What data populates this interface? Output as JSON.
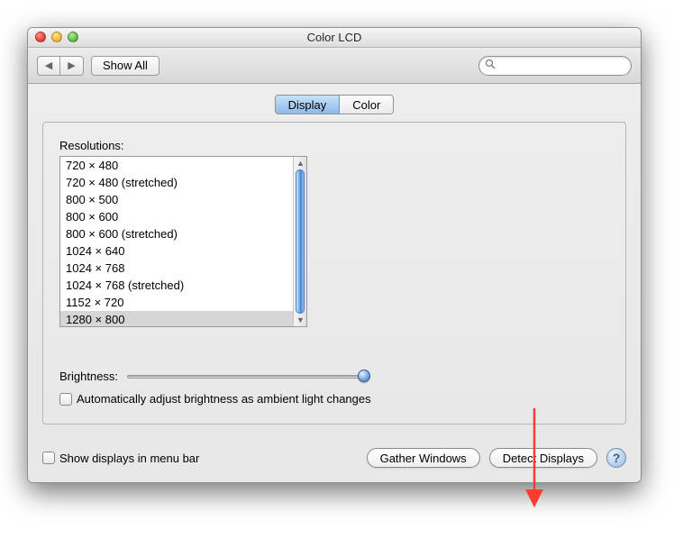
{
  "window": {
    "title": "Color LCD"
  },
  "toolbar": {
    "showAll": "Show All"
  },
  "tabs": {
    "display": "Display",
    "color": "Color"
  },
  "labels": {
    "resolutions": "Resolutions:",
    "brightness": "Brightness:",
    "autoBrightness": "Automatically adjust brightness as ambient light changes",
    "showInMenuBar": "Show displays in menu bar"
  },
  "resolutions": [
    "720 × 480",
    "720 × 480 (stretched)",
    "800 × 500",
    "800 × 600",
    "800 × 600 (stretched)",
    "1024 × 640",
    "1024 × 768",
    "1024 × 768 (stretched)",
    "1152 × 720",
    "1280 × 800"
  ],
  "selectedResolutionIndex": 9,
  "buttons": {
    "gather": "Gather Windows",
    "detect": "Detect Displays"
  },
  "help": "?"
}
